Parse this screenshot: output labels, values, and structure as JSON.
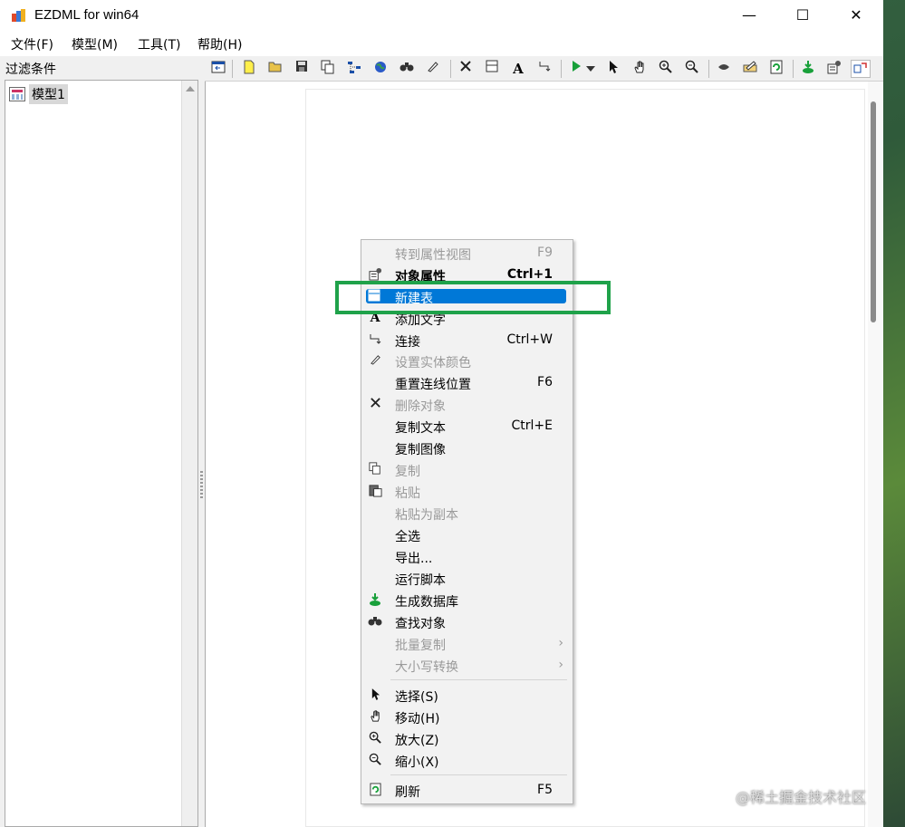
{
  "window": {
    "title": "EZDML for win64",
    "controls": {
      "minimize": "—",
      "maximize": "☐",
      "close": "✕"
    }
  },
  "menubar": {
    "items": [
      "文件(F)",
      "模型(M)",
      "工具(T)",
      "帮助(H)"
    ]
  },
  "left_panel": {
    "filter_label": "过滤条件",
    "tree_items": [
      {
        "label": "模型1",
        "icon": "model-icon"
      }
    ]
  },
  "toolbar": {
    "buttons": [
      "panel-toggle-icon",
      "new-icon",
      "open-icon",
      "save-icon",
      "copy-icon",
      "layout-icon",
      "globe-icon",
      "find-icon",
      "pen-icon",
      "delete-icon",
      "table-icon",
      "text-icon",
      "connect-icon",
      "run-icon",
      "dropdown-icon",
      "select-icon",
      "hand-icon",
      "zoom-in-icon",
      "zoom-out-icon",
      "hide-icon",
      "edit-icon",
      "refresh-icon",
      "generate-db-icon",
      "properties-icon",
      "switch-icon"
    ]
  },
  "context_menu": {
    "items": [
      {
        "label": "转到属性视图",
        "shortcut": "F9",
        "disabled": true,
        "icon": ""
      },
      {
        "label": "对象属性",
        "shortcut": "Ctrl+1",
        "bold": true,
        "icon": "properties-icon"
      },
      {
        "label": "新建表",
        "shortcut": "",
        "highlighted": true,
        "icon": "table-icon"
      },
      {
        "label": "添加文字",
        "shortcut": "",
        "icon": "text-icon"
      },
      {
        "label": "连接",
        "shortcut": "Ctrl+W",
        "icon": "connect-icon"
      },
      {
        "label": "设置实体颜色",
        "shortcut": "",
        "disabled": true,
        "icon": "pen-icon"
      },
      {
        "label": "重置连线位置",
        "shortcut": "F6",
        "icon": ""
      },
      {
        "label": "删除对象",
        "shortcut": "",
        "disabled": true,
        "icon": "delete-icon"
      },
      {
        "label": "复制文本",
        "shortcut": "Ctrl+E",
        "icon": ""
      },
      {
        "label": "复制图像",
        "shortcut": "",
        "icon": ""
      },
      {
        "label": "复制",
        "shortcut": "",
        "disabled": true,
        "icon": "copy-icon"
      },
      {
        "label": "粘贴",
        "shortcut": "",
        "disabled": true,
        "icon": "paste-icon"
      },
      {
        "label": "粘贴为副本",
        "shortcut": "",
        "disabled": true,
        "icon": ""
      },
      {
        "label": "全选",
        "shortcut": "",
        "icon": ""
      },
      {
        "label": "导出...",
        "shortcut": "",
        "icon": ""
      },
      {
        "label": "运行脚本",
        "shortcut": "",
        "icon": ""
      },
      {
        "label": "生成数据库",
        "shortcut": "",
        "icon": "generate-db-icon"
      },
      {
        "label": "查找对象",
        "shortcut": "",
        "icon": "find-icon"
      },
      {
        "label": "批量复制",
        "shortcut": "",
        "disabled": true,
        "submenu": true,
        "icon": ""
      },
      {
        "label": "大小写转换",
        "shortcut": "",
        "disabled": true,
        "submenu": true,
        "icon": ""
      },
      {
        "label": "选择(S)",
        "shortcut": "",
        "icon": "select-icon"
      },
      {
        "label": "移动(H)",
        "shortcut": "",
        "icon": "hand-icon"
      },
      {
        "label": "放大(Z)",
        "shortcut": "",
        "icon": "zoom-in-icon"
      },
      {
        "label": "缩小(X)",
        "shortcut": "",
        "icon": "zoom-out-icon"
      },
      {
        "label": "刷新",
        "shortcut": "F5",
        "icon": "refresh-icon"
      }
    ]
  },
  "watermark": "@稀土掘金技术社区",
  "colors": {
    "highlight": "#0078d7",
    "annotation_box": "#1fa24a"
  }
}
